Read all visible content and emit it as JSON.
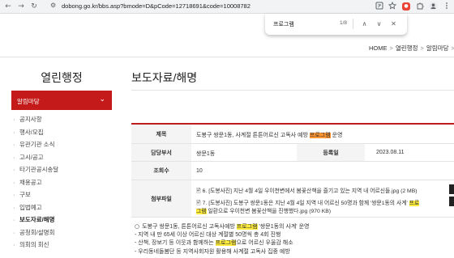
{
  "browser": {
    "back_glyph": "←",
    "forward_glyph": "→",
    "reload_glyph": "↻",
    "tune_glyph": "⚙",
    "url": "dobong.go.kr/bbs.asp?bmode=D&pCode=12718691&code=10008782",
    "icons": [
      "translate-icon",
      "star-icon",
      "extension-icon",
      "puzzle-icon",
      "profile-icon",
      "menu-icon"
    ]
  },
  "find_bar": {
    "query": "프로그램",
    "count": "1/8",
    "up_glyph": "∧",
    "down_glyph": "∨",
    "close_glyph": "✕"
  },
  "breadcrumb": {
    "items": [
      "HOME",
      "열린행정",
      "알림마당"
    ]
  },
  "sidebar": {
    "title": "열린행정",
    "active_label": "알림마당",
    "chevron_glyph": "⌄",
    "items": [
      {
        "label": "공지사항"
      },
      {
        "label": "행사/모집"
      },
      {
        "label": "유관기관 소식"
      },
      {
        "label": "고시/공고"
      },
      {
        "label": "타기관공시송달"
      },
      {
        "label": "채용공고"
      },
      {
        "label": "구보"
      },
      {
        "label": "입법예고"
      },
      {
        "label": "보도자료/해명"
      },
      {
        "label": "공청회/설명회"
      },
      {
        "label": "의회의 회신"
      }
    ]
  },
  "main": {
    "title": "보도자료/해명",
    "table": {
      "subject_label": "제목",
      "subject_pre": "도봉구 쌍문1동, 사계절 튼튼어르신 고독사 예방 ",
      "subject_hl": "프로그램",
      "subject_post": " 운영",
      "dept_label": "담당부서",
      "dept_value": "쌍문1동",
      "date_label": "등록일",
      "date_value": "2023.08.11",
      "views_label": "조회수",
      "views_value": "10",
      "attach_label": "첨부파일",
      "attachments": [
        {
          "line1": "6. [도봉사진] 지난 4월 4일 우이천변에서 봄꽃산책을 즐기고 있는 지역 내 어르신들.jpg (2 MB)"
        },
        {
          "line1_pre": "7. [도봉사진] 도봉구 쌍문1동은 지난 4월 4일 지역 내 어르신 50명과 함께 '쌍문1동의 사계' ",
          "line1_hl": "프로",
          "line2_hl": "그램",
          "line2_post": " 일환으로 우이천변 봄꽃산책을 진행했다.jpg (970 KB)"
        }
      ],
      "file_glyph": "🖹"
    },
    "body": {
      "bullet_glyph": "○",
      "line1_pre": "도봉구 쌍문1동, 튼튼어르신 고독사예방 ",
      "line1_hl": "프로그램",
      "line1_post": " '쌍문1동의 사계' 운영",
      "line2": "- 지역 내 만 65세 이상 어르신 대상 계절별 50명씩 총 4회 진행",
      "line3_pre": "- 산책, 장보기 등 이웃과 함께하는 ",
      "line3_hl": "프로그램",
      "line3_post": "으로 어르신 우울감 해소",
      "line4": "- 우리동네돌봄단 등 지역사회자원 활용해 사계절 고독사 집중 예방"
    }
  }
}
